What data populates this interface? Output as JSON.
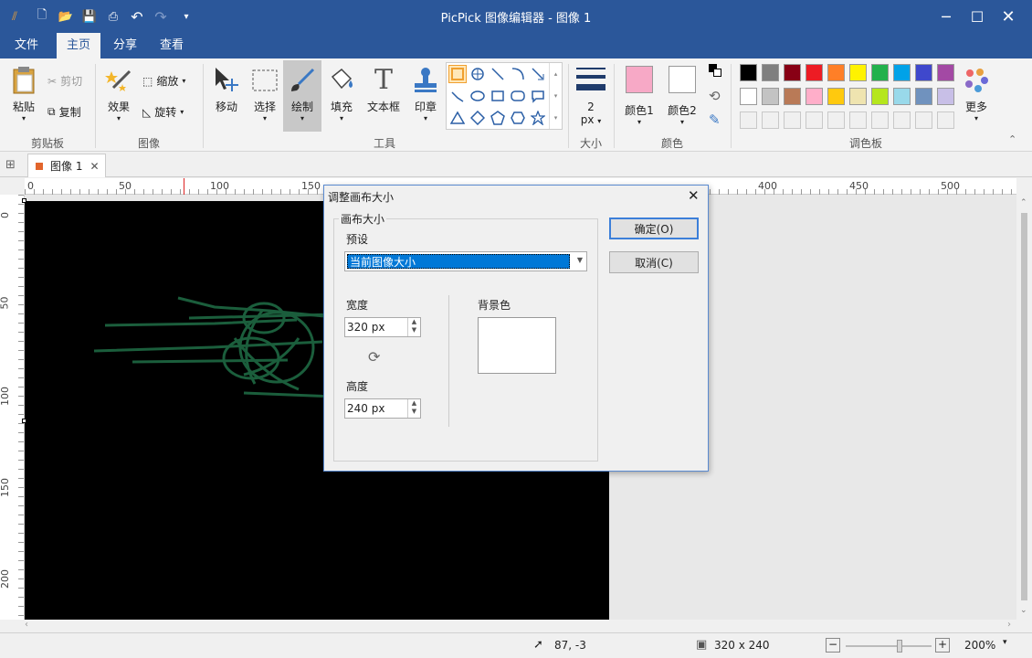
{
  "window": {
    "title": "PicPick 图像编辑器 - 图像 1"
  },
  "menu": {
    "tabs": [
      "文件",
      "主页",
      "分享",
      "查看"
    ],
    "active": "主页"
  },
  "ribbon": {
    "clipboard": {
      "paste": "粘贴",
      "cut": "剪切",
      "copy": "复制",
      "group": "剪贴板"
    },
    "image": {
      "effects": "效果",
      "resize": "缩放",
      "rotate": "旋转",
      "group": "图像"
    },
    "tools": {
      "move": "移动",
      "select": "选择",
      "draw": "绘制",
      "fill": "填充",
      "textbox": "文本框",
      "stamp": "印章",
      "group": "工具"
    },
    "size": {
      "value": "2",
      "unit": "px",
      "group": "大小"
    },
    "color": {
      "color1": "颜色1",
      "color2": "颜色2",
      "group": "颜色",
      "color1_hex": "#f7a9c6",
      "color2_hex": "#ffffff"
    },
    "palette": {
      "group": "调色板",
      "more": "更多",
      "row1": [
        "#000000",
        "#7f7f7f",
        "#880015",
        "#ed1c24",
        "#ff7f27",
        "#fff200",
        "#22b14c",
        "#00a2e8",
        "#3f48cc",
        "#a349a4"
      ],
      "row2": [
        "#ffffff",
        "#c3c3c3",
        "#b97a57",
        "#ffaec9",
        "#ffc90e",
        "#efe4b0",
        "#b5e61d",
        "#99d9ea",
        "#7092be",
        "#c8bfe7"
      ],
      "row3": [
        "#f0f0f0",
        "#f0f0f0",
        "#f0f0f0",
        "#f0f0f0",
        "#f0f0f0",
        "#f0f0f0",
        "#f0f0f0",
        "#f0f0f0",
        "#f0f0f0",
        "#f0f0f0"
      ]
    }
  },
  "document": {
    "tab_label": "图像 1"
  },
  "ruler": {
    "h": [
      "0",
      "50",
      "100",
      "150",
      "400",
      "450",
      "500"
    ],
    "v": [
      "0",
      "50",
      "100",
      "150",
      "200"
    ]
  },
  "dialog": {
    "title": "调整画布大小",
    "groupbox": "画布大小",
    "preset_label": "预设",
    "preset_value": "当前图像大小",
    "width_label": "宽度",
    "width_value": "320 px",
    "height_label": "高度",
    "height_value": "240 px",
    "bg_label": "背景色",
    "ok": "确定(O)",
    "cancel": "取消(C)"
  },
  "status": {
    "cursor": "87, -3",
    "image_size": "320 x 240",
    "zoom": "200%"
  }
}
